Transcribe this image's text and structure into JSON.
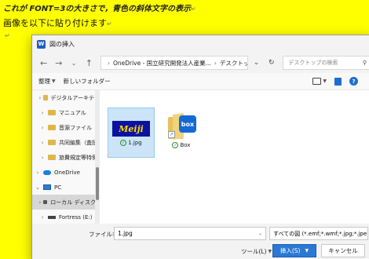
{
  "document": {
    "line1": "これが FONT=3の大きさで，青色の斜体文字の表示",
    "line2": "画像を以下に貼り付けます",
    "paragraph_mark": "↵"
  },
  "dialog": {
    "title": "図の挿入",
    "address": {
      "root": "OneDrive - 国立研究開発法人産業...",
      "current": "デスクトップ"
    },
    "search_placeholder": "デスクトップの検索",
    "toolbar": {
      "organize": "整理",
      "new_folder": "新しいフォルダー"
    },
    "sidebar": [
      {
        "label": "デジタルアーキテク",
        "type": "folder",
        "expand": "›"
      },
      {
        "label": "マニュアル",
        "type": "folder",
        "expand": "›"
      },
      {
        "label": "音源ファイル",
        "type": "folder",
        "expand": "›"
      },
      {
        "label": "共同編集（査読",
        "type": "folder",
        "expand": "›"
      },
      {
        "label": "旅費規定等特例",
        "type": "folder",
        "expand": "›"
      },
      {
        "label": "OneDrive",
        "type": "onedrive",
        "expand": "›"
      },
      {
        "label": "PC",
        "type": "pc",
        "expand": "⌄"
      },
      {
        "label": "ローカル ディスク (",
        "type": "disk",
        "expand": "›",
        "selected": true
      },
      {
        "label": "Fortress (E:)",
        "type": "drive",
        "expand": "›"
      }
    ],
    "files": [
      {
        "name": "1.jpg",
        "thumb_text": "Meiji",
        "selected": true
      },
      {
        "name": "Box",
        "logo_text": "box",
        "selected": false
      }
    ],
    "filename_label": "ファイル名(N):",
    "filename_value": "1.jpg",
    "filter": "すべての図 (*.emf;*.wmf;*.jpg;*.jpe",
    "tools_label": "ツール(L)",
    "insert_label": "挿入(S)",
    "cancel_label": "キャンセル"
  },
  "colors": {
    "page_background": "#ffff00",
    "accent": "#2a78d4",
    "thumb_bg": "#0a12a0",
    "thumb_text": "#ffd800"
  }
}
